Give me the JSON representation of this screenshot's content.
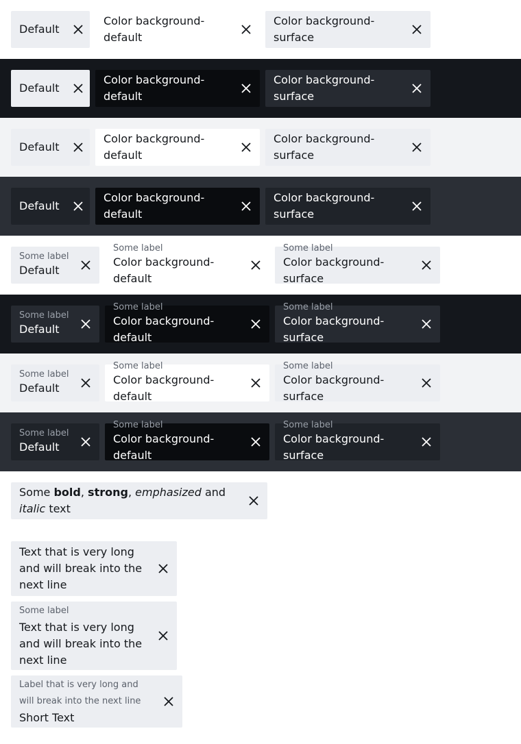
{
  "rows": [
    {
      "theme": "light",
      "tags": [
        "Default",
        "Color background-default",
        "Color background-surface"
      ]
    },
    {
      "theme": "dark",
      "tags": [
        "Default",
        "Color background-default",
        "Color background-surface"
      ]
    },
    {
      "theme": "alt-light",
      "tags": [
        "Default",
        "Color background-default",
        "Color background-surface"
      ]
    },
    {
      "theme": "alt-dark",
      "tags": [
        "Default",
        "Color background-default",
        "Color background-surface"
      ]
    }
  ],
  "labeled_rows": [
    {
      "theme": "light",
      "label": "Some label",
      "tags": [
        "Default",
        "Color background-default",
        "Color background-surface"
      ]
    },
    {
      "theme": "dark",
      "label": "Some label",
      "tags": [
        "Default",
        "Color background-default",
        "Color background-surface"
      ]
    },
    {
      "theme": "alt-light",
      "label": "Some label",
      "tags": [
        "Default",
        "Color background-default",
        "Color background-surface"
      ]
    },
    {
      "theme": "alt-dark",
      "label": "Some label",
      "tags": [
        "Default",
        "Color background-default",
        "Color background-surface"
      ]
    }
  ],
  "rich_tag": {
    "some": "Some",
    "bold": "bold",
    "comma1": ",",
    "strong": "strong",
    "comma2": ",",
    "emphasized": "emphasized",
    "and": "and",
    "italic": "italic",
    "text": "text"
  },
  "long_tag": {
    "text": "Text that is very long and will break into the next line"
  },
  "long_labeled_tag": {
    "label": "Some label",
    "text": "Text that is very long and will break into the next line"
  },
  "long_label_tag": {
    "label": "Label that is very long and will break into the next line",
    "text": "Short Text"
  },
  "colors": {
    "surface": "#eceef2",
    "dark": "#14171c",
    "alt_light": "#f2f3f5",
    "alt_dark": "#2b2f36"
  },
  "icons": {
    "close": "close-icon"
  }
}
